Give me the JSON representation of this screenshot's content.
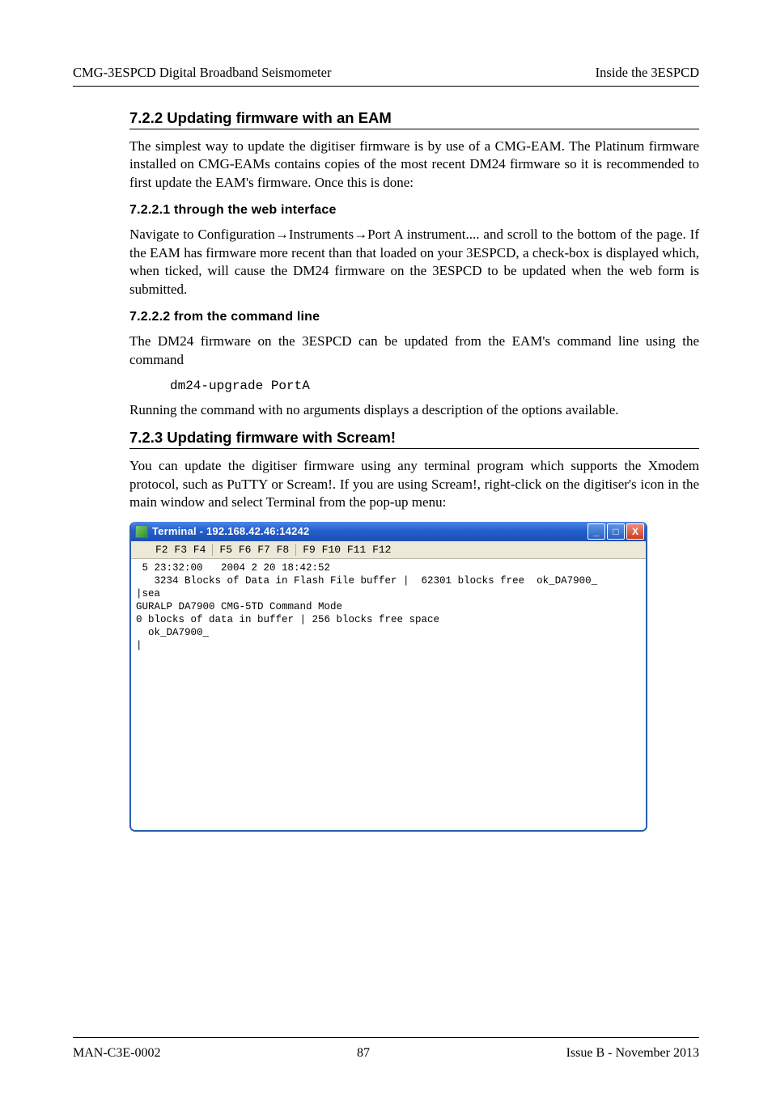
{
  "header": {
    "left": "CMG-3ESPCD Digital Broadband Seismometer",
    "right": "Inside the 3ESPCD"
  },
  "sec722": {
    "title": "7.2.2  Updating firmware with an EAM",
    "p1": "The simplest way to update the digitiser firmware is by use of a CMG-EAM. The Platinum firmware installed on CMG-EAMs contains copies of the most recent DM24 firmware so it is recommended to first update the EAM's firmware.  Once this is done:"
  },
  "sec7221": {
    "title": "7.2.2.1  through the web interface",
    "p1": "Navigate to Configuration→Instruments→Port A instrument.... and scroll to the bottom of the page.  If the EAM has firmware more recent than that loaded on your 3ESPCD, a check-box is displayed which, when ticked, will cause the DM24 firmware on the 3ESPCD to be updated when the web form is submitted."
  },
  "sec7222": {
    "title": "7.2.2.2  from the command line",
    "p1": "The DM24 firmware on the 3ESPCD can be updated from the EAM's command line using the command",
    "code": "dm24-upgrade PortA",
    "p2": "Running the command with no arguments displays a description of the options available."
  },
  "sec723": {
    "title": "7.2.3  Updating firmware with Scream!",
    "p1": "You can update the digitiser firmware using any terminal program which supports the Xmodem protocol, such as PuTTY or Scream!. If you are using Scream!, right-click on the digitiser's icon in the main window and select Terminal from the pop-up menu:"
  },
  "terminal": {
    "title": "Terminal - 192.168.42.46:14242",
    "min": "_",
    "max": "□",
    "close": "X",
    "menu": {
      "seg1": "F2 F3 F4",
      "seg2": "F5 F6 F7 F8",
      "seg3": "F9 F10 F11 F12"
    },
    "body": " 5 23:32:00   2004 2 20 18:42:52\n   3234 Blocks of Data in Flash File buffer |  62301 blocks free  ok_DA7900_\n|sea\nGURALP DA7900 CMG-5TD Command Mode\n0 blocks of data in buffer | 256 blocks free space\n  ok_DA7900_\n|"
  },
  "footer": {
    "left": "MAN-C3E-0002",
    "center": "87",
    "right": "Issue B  - November 2013"
  }
}
